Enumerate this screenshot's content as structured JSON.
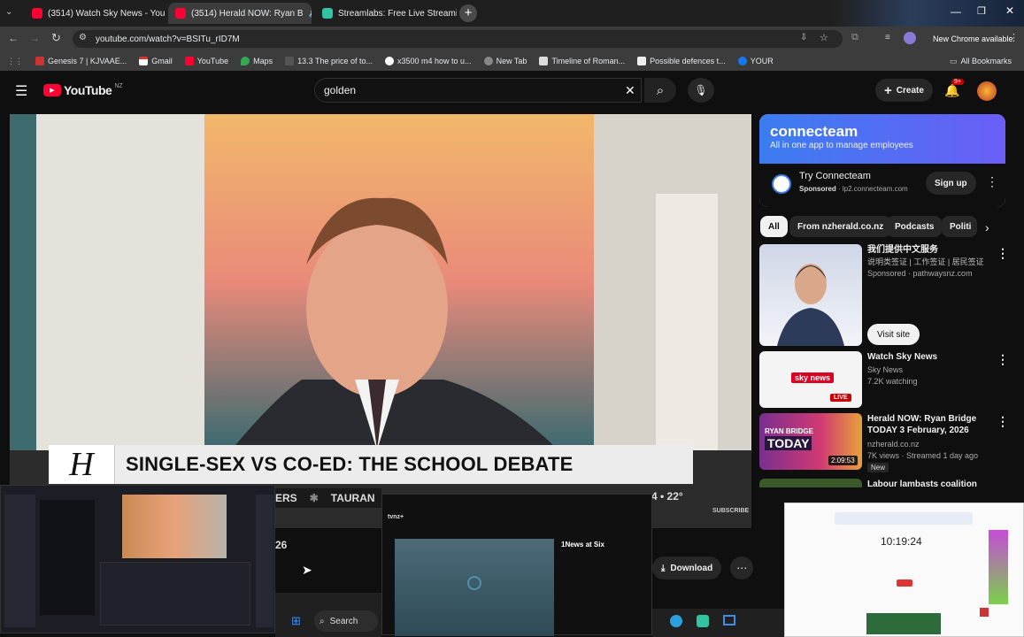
{
  "browser": {
    "tabs": [
      {
        "title": "(3514) Watch Sky News - YouTu",
        "active": false
      },
      {
        "title": "(3514) Herald NOW: Ryan B",
        "active": true
      },
      {
        "title": "Streamlabs: Free Live Streamin",
        "active": false
      }
    ],
    "url": "youtube.com/watch?v=BSITu_rID7M",
    "new_chrome": "New Chrome available",
    "bookmarks": [
      "Genesis 7 | KJVAAE...",
      "Gmail",
      "YouTube",
      "Maps",
      "13.3 The price of to...",
      "x3500 m4 how to u...",
      "New Tab",
      "Timeline of Roman...",
      "Possible defences t...",
      "YOUR"
    ],
    "all_bookmarks": "All Bookmarks"
  },
  "youtube": {
    "logo": "YouTube",
    "region": "NZ",
    "search_value": "golden",
    "create_label": "Create",
    "notif_count": "9+"
  },
  "video": {
    "banner_title": "SINGLE-SEX VS CO-ED: THE SCHOOL DEBATE",
    "ticker_left": "ERS",
    "ticker_mid": "TAURAN",
    "ticker_right": "4 • 22°",
    "subscribe": "SUBSCRIBE",
    "download_label": "Download",
    "partial_num": "26"
  },
  "ad": {
    "brand": "connecteam",
    "tagline": "All in one app to manage employees",
    "name": "Try Connecteam",
    "sponsored": "Sponsored",
    "domain": "lp2.connecteam.com",
    "cta": "Sign up"
  },
  "chips": [
    "All",
    "From nzherald.co.nz",
    "Podcasts",
    "Politi"
  ],
  "sidebar": [
    {
      "title": "我们提供中文服务",
      "sub": "说明类签证 | 工作签证 | 居民签证",
      "meta": "Sponsored · pathwaysnz.com",
      "cta": "Visit site"
    },
    {
      "title": "Watch Sky News",
      "channel": "Sky News",
      "meta": "7.2K watching",
      "badge": "LIVE"
    },
    {
      "title": "Herald NOW: Ryan Bridge TODAY 3 February, 2026",
      "channel": "nzherald.co.nz",
      "meta": "7K views · Streamed 1 day ago",
      "badge": "New",
      "duration": "2:09:53",
      "thumb_text1": "RYAN BRIDGE",
      "thumb_text2": "TODAY"
    },
    {
      "title": "Labour lambasts coalition over"
    }
  ],
  "overlays": {
    "search_label": "Search",
    "news_title": "1News at Six",
    "clock": "10:19:24"
  }
}
